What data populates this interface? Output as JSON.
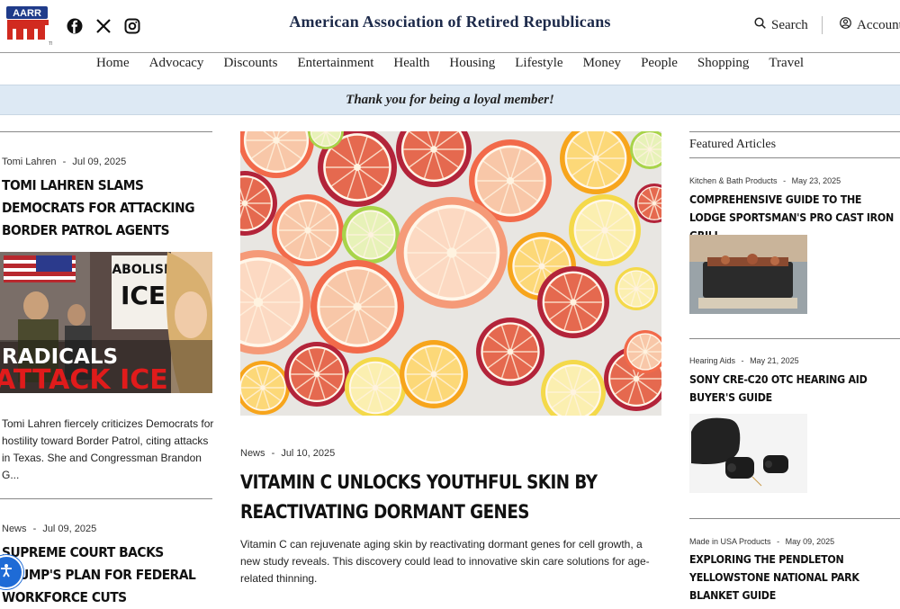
{
  "header": {
    "logo_text": "AARR",
    "site_title": "American Association of Retired Republicans",
    "search_label": "Search",
    "account_label": "Account",
    "social": [
      "facebook-icon",
      "x-icon",
      "instagram-icon"
    ]
  },
  "nav": {
    "items": [
      "Home",
      "Advocacy",
      "Discounts",
      "Entertainment",
      "Health",
      "Housing",
      "Lifestyle",
      "Money",
      "People",
      "Shopping",
      "Travel"
    ]
  },
  "banner": {
    "text": "Thank you for being a loyal member!"
  },
  "left": {
    "article1": {
      "author": "Tomi Lahren",
      "date": "Jul 09, 2025",
      "title": "Tomi Lahren Slams Democrats for Attacking Border Patrol Agents",
      "image_text_top": "ABOLISH ICE",
      "image_text_bottom1": "RADICALS",
      "image_text_bottom2": "ATTACK ICE",
      "excerpt": "Tomi Lahren fiercely criticizes Democrats for hostility toward Border Patrol, citing attacks in Texas. She and Congressman Brandon G..."
    },
    "article2": {
      "category": "News",
      "date": "Jul 09, 2025",
      "title": "Supreme Court Backs Trump's Plan for Federal Workforce Cuts"
    }
  },
  "center": {
    "category": "News",
    "date": "Jul 10, 2025",
    "title": "Vitamin C Unlocks Youthful Skin by Reactivating Dormant Genes",
    "excerpt": "Vitamin C can rejuvenate aging skin by reactivating dormant genes for cell growth, a new study reveals. This discovery could lead to innovative skin care solutions for age-related thinning."
  },
  "right": {
    "section_title": "Featured Articles",
    "articles": [
      {
        "category": "Kitchen & Bath Products",
        "date": "May 23, 2025",
        "title": "Comprehensive Guide to the Lodge Sportsman's Pro Cast Iron Grill"
      },
      {
        "category": "Hearing Aids",
        "date": "May 21, 2025",
        "title": "Sony CRE-C20 OTC Hearing Aid Buyer's Guide"
      },
      {
        "category": "Made in USA Products",
        "date": "May 09, 2025",
        "title": "Exploring the Pendleton Yellowstone National Park Blanket Guide"
      }
    ]
  },
  "colors": {
    "brand_blue": "#1f3b8a",
    "brand_red": "#d12a20",
    "banner_bg": "#dde9f4",
    "accessibility_blue": "#1e6bd6"
  }
}
